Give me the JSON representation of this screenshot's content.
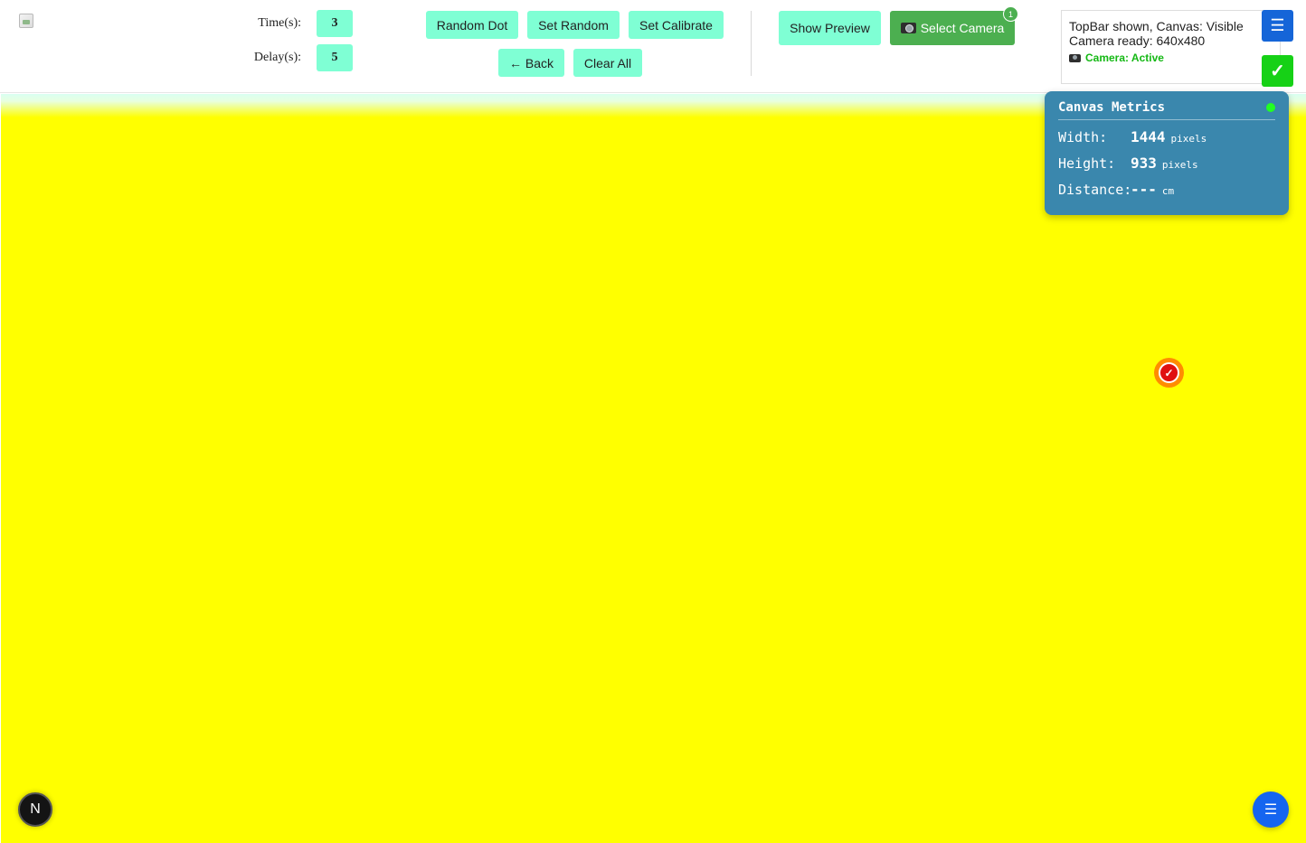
{
  "topbar": {
    "time_label": "Time(s):",
    "time_value": "3",
    "delay_label": "Delay(s):",
    "delay_value": "5",
    "buttons": {
      "random_dot": "Random Dot",
      "set_random": "Set Random",
      "set_calibrate": "Set Calibrate",
      "back": "← Back",
      "clear_all": "Clear All",
      "show_preview": "Show Preview",
      "select_camera": "Select Camera",
      "camera_badge": "1"
    },
    "status": {
      "line1": "TopBar shown, Canvas: Visible",
      "line2": "Camera ready: 640x480",
      "camera_status": "Camera: Active"
    },
    "menu_icon": "menu-icon",
    "check_icon": "check-icon"
  },
  "metrics": {
    "title": "Canvas Metrics",
    "width_label": "Width:",
    "width_value": "1444",
    "height_label": "Height:",
    "height_value": "933",
    "distance_label": "Distance:",
    "distance_value": "---",
    "unit_pixels": "pixels",
    "unit_cm": "cm"
  },
  "canvas": {
    "background_color": "#ffff00",
    "dot_mark": "✓"
  },
  "floating": {
    "n_label": "N",
    "menu_icon": "menu-icon"
  },
  "colors": {
    "accent_button": "#7fffd4",
    "camera_button": "#4caf50",
    "menu_blue": "#1565d8",
    "check_green": "#16d116",
    "metrics_panel": "#3a87ad",
    "target_red": "#e01010",
    "target_orange": "#ff8c00"
  }
}
